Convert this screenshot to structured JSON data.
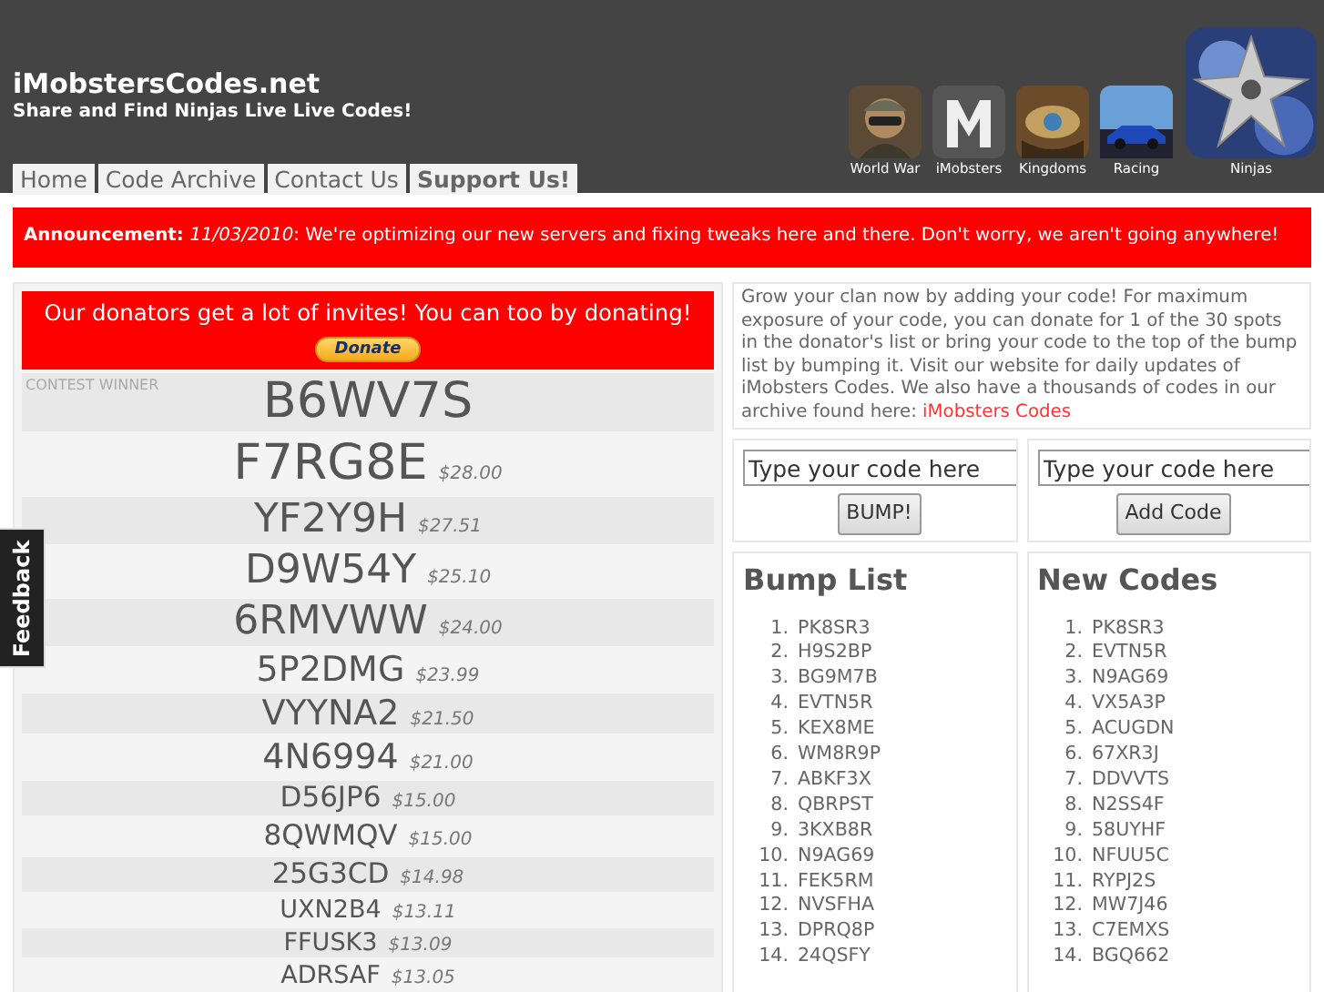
{
  "site": {
    "title": "iMobstersCodes.net",
    "tagline": "Share and Find Ninjas Live Live Codes!"
  },
  "tabs": [
    {
      "label": "Home",
      "selected": false
    },
    {
      "label": "Code Archive",
      "selected": false
    },
    {
      "label": "Contact Us",
      "selected": false
    },
    {
      "label": "Support Us!",
      "selected": true
    }
  ],
  "games": [
    {
      "label": "World War",
      "kind": "soldier"
    },
    {
      "label": "iMobsters",
      "kind": "letter"
    },
    {
      "label": "Kingdoms",
      "kind": "eye"
    },
    {
      "label": "Racing",
      "kind": "car"
    },
    {
      "label": "Ninjas",
      "kind": "star"
    }
  ],
  "announcement": {
    "label": "Announcement:",
    "date": "11/03/2010",
    "text": ": We're optimizing our new servers and fixing tweaks here and there. Don't worry, we aren't going anywhere!"
  },
  "donate_banner": {
    "text": "Our donators get a lot of invites! You can too by donating!",
    "button": "Donate"
  },
  "contest_label": "CONTEST WINNER",
  "donators": [
    {
      "code": "B6WV7S",
      "kind": "xl"
    },
    {
      "code": "F7RG8E",
      "amount": "$28.00",
      "kind": "xl"
    },
    {
      "code": "YF2Y9H",
      "amount": "$27.51",
      "kind": "lg"
    },
    {
      "code": "D9W54Y",
      "amount": "$25.10",
      "kind": "lg"
    },
    {
      "code": "6RMVWW",
      "amount": "$24.00",
      "kind": "lg"
    },
    {
      "code": "5P2DMG",
      "amount": "$23.99",
      "kind": "md"
    },
    {
      "code": "VYYNA2",
      "amount": "$21.50",
      "kind": "md"
    },
    {
      "code": "4N6994",
      "amount": "$21.00",
      "kind": "md"
    },
    {
      "code": "D56JP6",
      "amount": "$15.00",
      "kind": "sm"
    },
    {
      "code": "8QWMQV",
      "amount": "$15.00",
      "kind": "sm"
    },
    {
      "code": "25G3CD",
      "amount": "$14.98",
      "kind": "sm"
    },
    {
      "code": "UXN2B4",
      "amount": "$13.11",
      "kind": "xs"
    },
    {
      "code": "FFUSK3",
      "amount": "$13.09",
      "kind": "xs"
    },
    {
      "code": "ADRSAF",
      "amount": "$13.05",
      "kind": "xs"
    }
  ],
  "intro": {
    "text": "Grow your clan now by adding your code! For maximum exposure of your code, you can donate for 1 of the 30 spots in the donator's list or bring your code to the top of the bump list by bumping it. Visit our website for daily updates of iMobsters Codes. We also have a thousands of codes in our archive found here: ",
    "link": "iMobsters Codes"
  },
  "bump_form": {
    "placeholder": "Type your code here",
    "button": "BUMP!"
  },
  "add_form": {
    "placeholder": "Type your code here",
    "button": "Add Code"
  },
  "bump_list": {
    "title": "Bump List",
    "items": [
      {
        "num": "1.",
        "code": "PK8SR3"
      },
      {
        "num": "2.",
        "code": "H9S2BP"
      },
      {
        "num": "3.",
        "code": "BG9M7B"
      },
      {
        "num": "4.",
        "code": "EVTN5R"
      },
      {
        "num": "5.",
        "code": "KEX8ME"
      },
      {
        "num": "6.",
        "code": "WM8R9P"
      },
      {
        "num": "7.",
        "code": "ABKF3X"
      },
      {
        "num": "8.",
        "code": "QBRPST"
      },
      {
        "num": "9.",
        "code": "3KXB8R"
      },
      {
        "num": "10.",
        "code": "N9AG69"
      },
      {
        "num": "11.",
        "code": "FEK5RM"
      },
      {
        "num": "12.",
        "code": "NVSFHA"
      },
      {
        "num": "13.",
        "code": "DPRQ8P"
      },
      {
        "num": "14.",
        "code": "24QSFY"
      }
    ]
  },
  "new_codes": {
    "title": "New Codes",
    "items": [
      {
        "num": "1.",
        "code": "PK8SR3"
      },
      {
        "num": "2.",
        "code": "EVTN5R"
      },
      {
        "num": "3.",
        "code": "N9AG69"
      },
      {
        "num": "4.",
        "code": "VX5A3P"
      },
      {
        "num": "5.",
        "code": "ACUGDN"
      },
      {
        "num": "6.",
        "code": "67XR3J"
      },
      {
        "num": "7.",
        "code": "DDVVTS"
      },
      {
        "num": "8.",
        "code": "N2SS4F"
      },
      {
        "num": "9.",
        "code": "58UYHF"
      },
      {
        "num": "10.",
        "code": "NFUU5C"
      },
      {
        "num": "11.",
        "code": "RYPJ2S"
      },
      {
        "num": "12.",
        "code": "MW7J46"
      },
      {
        "num": "13.",
        "code": "C7EMXS"
      },
      {
        "num": "14.",
        "code": "BGQ662"
      }
    ]
  },
  "feedback": "Feedback"
}
